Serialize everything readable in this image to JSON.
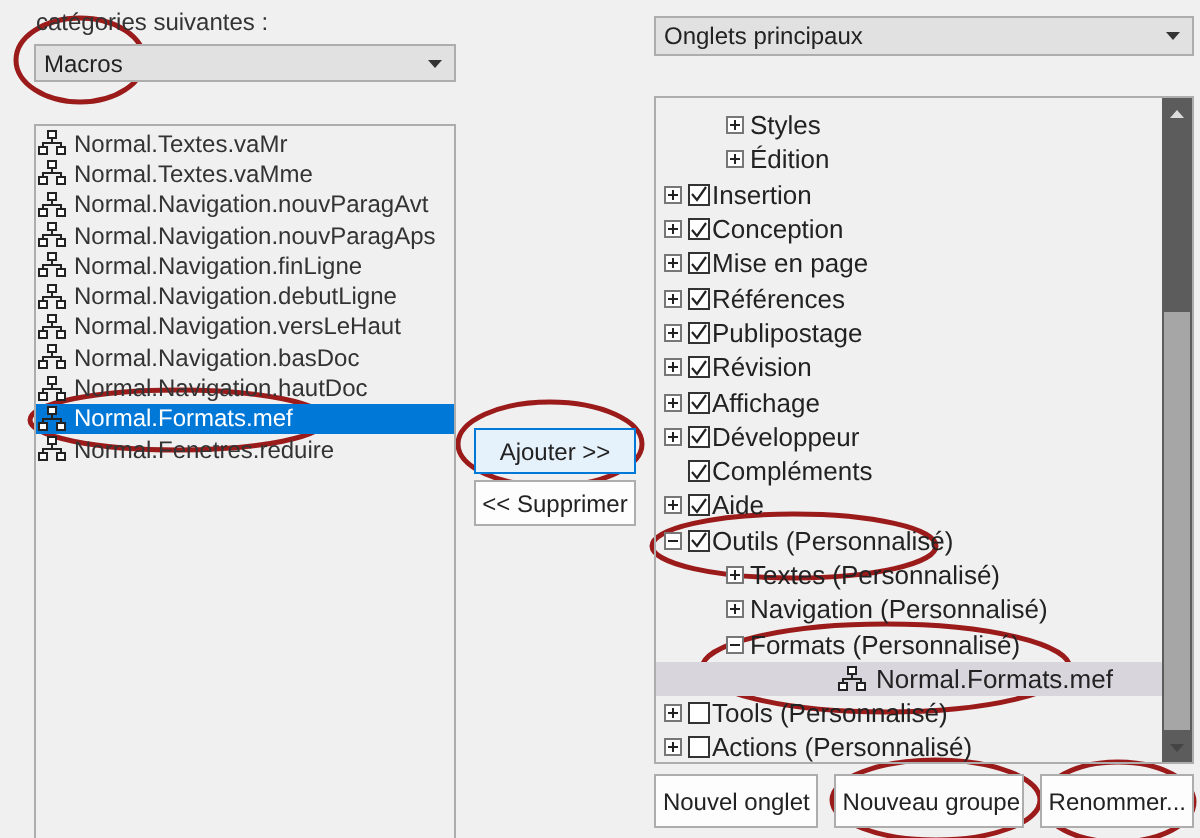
{
  "left": {
    "label": "catégories suivantes :",
    "dropdown": {
      "value": "Macros"
    },
    "list": [
      {
        "label": "Normal.Textes.vaMr",
        "selected": false
      },
      {
        "label": "Normal.Textes.vaMme",
        "selected": false
      },
      {
        "label": "Normal.Navigation.nouvParagAvt",
        "selected": false
      },
      {
        "label": "Normal.Navigation.nouvParagAps",
        "selected": false
      },
      {
        "label": "Normal.Navigation.finLigne",
        "selected": false
      },
      {
        "label": "Normal.Navigation.debutLigne",
        "selected": false
      },
      {
        "label": "Normal.Navigation.versLeHaut",
        "selected": false
      },
      {
        "label": "Normal.Navigation.basDoc",
        "selected": false
      },
      {
        "label": "Normal.Navigation.hautDoc",
        "selected": false
      },
      {
        "label": "Normal.Formats.mef",
        "selected": true
      },
      {
        "label": "Normal.Fenetres.reduire",
        "selected": false
      }
    ]
  },
  "middle": {
    "buttons": [
      {
        "label": "Ajouter >>",
        "kind": "primary"
      },
      {
        "label": "<< Supprimer",
        "kind": "normal"
      }
    ]
  },
  "right": {
    "dropdown": {
      "value": "Onglets principaux"
    },
    "tree": [
      {
        "kind": "hidden",
        "children": [
          {
            "kind": "group",
            "label": "Styles",
            "expanded": false,
            "selected": false
          },
          {
            "kind": "group",
            "label": "Édition",
            "expanded": false,
            "selected": false
          }
        ]
      },
      {
        "kind": "tab",
        "label": "Insertion",
        "checked": true,
        "expanded": false,
        "selected": false
      },
      {
        "kind": "tab",
        "label": "Conception",
        "checked": true,
        "expanded": false,
        "selected": false
      },
      {
        "kind": "tab",
        "label": "Mise en page",
        "checked": true,
        "expanded": false,
        "selected": false
      },
      {
        "kind": "tab",
        "label": "Références",
        "checked": true,
        "expanded": false,
        "selected": false
      },
      {
        "kind": "tab",
        "label": "Publipostage",
        "checked": true,
        "expanded": false,
        "selected": false
      },
      {
        "kind": "tab",
        "label": "Révision",
        "checked": true,
        "expanded": false,
        "selected": false
      },
      {
        "kind": "tab",
        "label": "Affichage",
        "checked": true,
        "expanded": false,
        "selected": false
      },
      {
        "kind": "tab",
        "label": "Développeur",
        "checked": true,
        "expanded": false,
        "selected": false
      },
      {
        "kind": "leaf-tab",
        "label": "Compléments",
        "checked": true,
        "selected": false
      },
      {
        "kind": "tab",
        "label": "Aide",
        "checked": true,
        "expanded": false,
        "selected": false
      },
      {
        "kind": "tab",
        "label": "Outils (Personnalisé)",
        "checked": true,
        "expanded": true,
        "selected": false,
        "children": [
          {
            "kind": "group",
            "label": "Textes (Personnalisé)",
            "expanded": false,
            "selected": false
          },
          {
            "kind": "group",
            "label": "Navigation (Personnalisé)",
            "expanded": false,
            "selected": false
          },
          {
            "kind": "group",
            "label": "Formats (Personnalisé)",
            "expanded": true,
            "selected": false,
            "children": [
              {
                "kind": "command",
                "label": "Normal.Formats.mef",
                "selected": true
              }
            ]
          }
        ]
      },
      {
        "kind": "tab",
        "label": "Tools (Personnalisé)",
        "checked": false,
        "expanded": false,
        "selected": false
      },
      {
        "kind": "tab",
        "label": "Actions (Personnalisé)",
        "checked": false,
        "expanded": false,
        "selected": false
      }
    ]
  },
  "buttons": [
    {
      "label": "Nouvel onglet"
    },
    {
      "label": "Nouveau groupe"
    },
    {
      "label": "Renommer..."
    }
  ]
}
